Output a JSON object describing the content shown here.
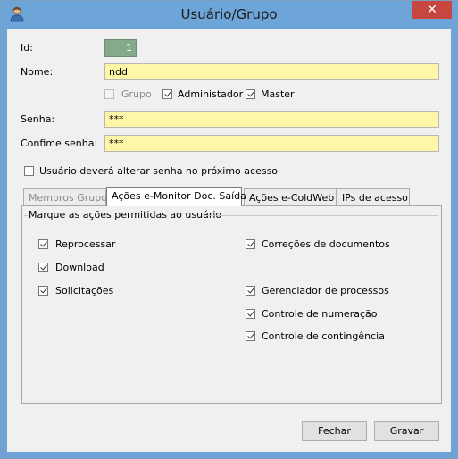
{
  "window": {
    "title": "Usuário/Grupo",
    "close_glyph": "✕"
  },
  "form": {
    "id_label": "Id:",
    "id_value": "1",
    "nome_label": "Nome:",
    "nome_value": "ndd",
    "grupo_label": "Grupo",
    "administrador_label": "Administador",
    "master_label": "Master",
    "senha_label": "Senha:",
    "senha_value": "***",
    "confirme_label": "Confime senha:",
    "confirme_value": "***",
    "alterar_label": "Usuário deverá alterar senha no próximo acesso"
  },
  "tabs": [
    {
      "label": "Membros Grupo"
    },
    {
      "label": "Ações e-Monitor Doc. Saída"
    },
    {
      "label": "Ações e-ColdWeb"
    },
    {
      "label": "IPs de acesso"
    }
  ],
  "group": {
    "title": "Marque as ações permitidas ao usuário"
  },
  "actions": [
    {
      "label": "Reprocessar",
      "checked": true
    },
    {
      "label": "Download",
      "checked": true
    },
    {
      "label": "Solicitações",
      "checked": true
    },
    {
      "label": "Correções de documentos",
      "checked": true
    },
    {
      "label": "Gerenciador de processos",
      "checked": true
    },
    {
      "label": "Controle de numeração",
      "checked": true
    },
    {
      "label": "Controle de contingência",
      "checked": true
    }
  ],
  "buttons": {
    "fechar": "Fechar",
    "gravar": "Gravar"
  },
  "colors": {
    "titlebar": "#6ea5d8",
    "field_bg": "#fdf7a7",
    "close_btn": "#c7463f"
  }
}
